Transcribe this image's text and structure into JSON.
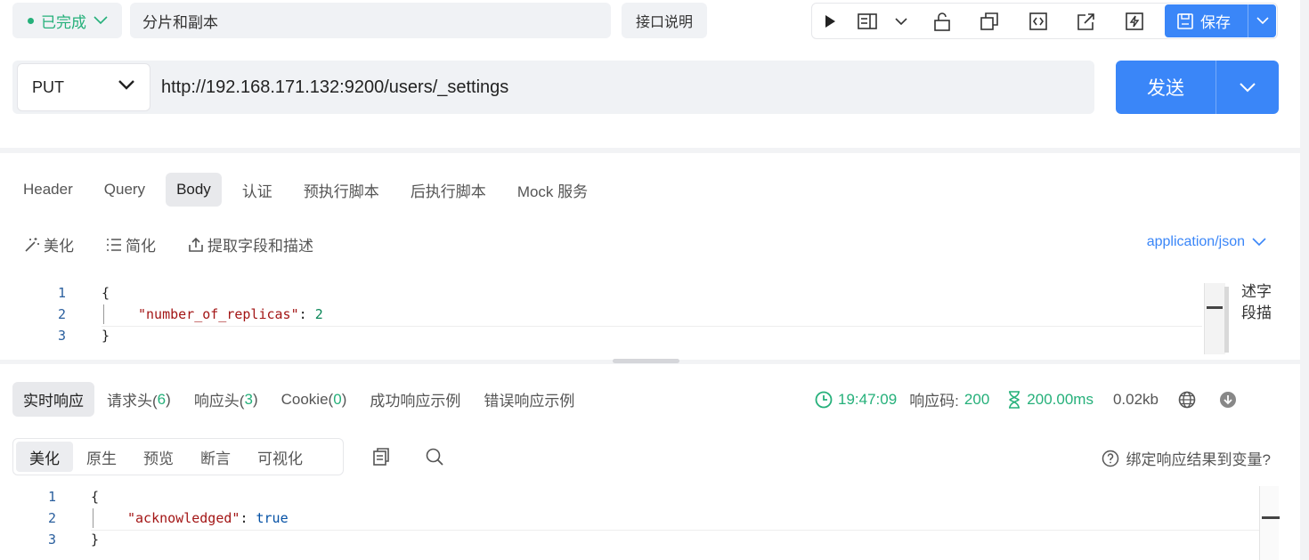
{
  "header": {
    "status_label": "已完成",
    "name": "分片和副本",
    "doc_button": "接口说明",
    "save_label": "保存"
  },
  "request": {
    "method": "PUT",
    "url": "http://192.168.171.132:9200/users/_settings",
    "send_label": "发送"
  },
  "request_tabs": [
    "Header",
    "Query",
    "Body",
    "认证",
    "预执行脚本",
    "后执行脚本",
    "Mock 服务"
  ],
  "body_tools": {
    "beautify": "美化",
    "simplify": "简化",
    "extract": "提取字段和描述",
    "content_type": "application/json"
  },
  "request_body": {
    "line_numbers": [
      "1",
      "2",
      "3"
    ],
    "open": "{",
    "key": "\"number_of_replicas\"",
    "colon": ": ",
    "value": "2",
    "close": "}",
    "side_panel_text": "述字段描"
  },
  "response_tabs": {
    "realtime": "实时响应",
    "req_headers": "请求头(",
    "req_headers_count": "6",
    "resp_headers": "响应头(",
    "resp_headers_count": "3",
    "cookie": "Cookie(",
    "cookie_count": "0",
    "close_paren": " )",
    "success_example": "成功响应示例",
    "error_example": "错误响应示例"
  },
  "response_stats": {
    "time": "19:47:09",
    "code_label": "响应码:",
    "code": "200",
    "duration": "200.00ms",
    "size": "0.02kb"
  },
  "view_tabs": [
    "美化",
    "原生",
    "预览",
    "断言",
    "可视化"
  ],
  "bind_label": "绑定响应结果到变量?",
  "response_body": {
    "line_numbers": [
      "1",
      "2",
      "3"
    ],
    "open": "{",
    "key": "\"acknowledged\"",
    "colon": ": ",
    "value": "true",
    "close": "}"
  },
  "colors": {
    "accent": "#3a86f8",
    "success": "#25b07a"
  }
}
